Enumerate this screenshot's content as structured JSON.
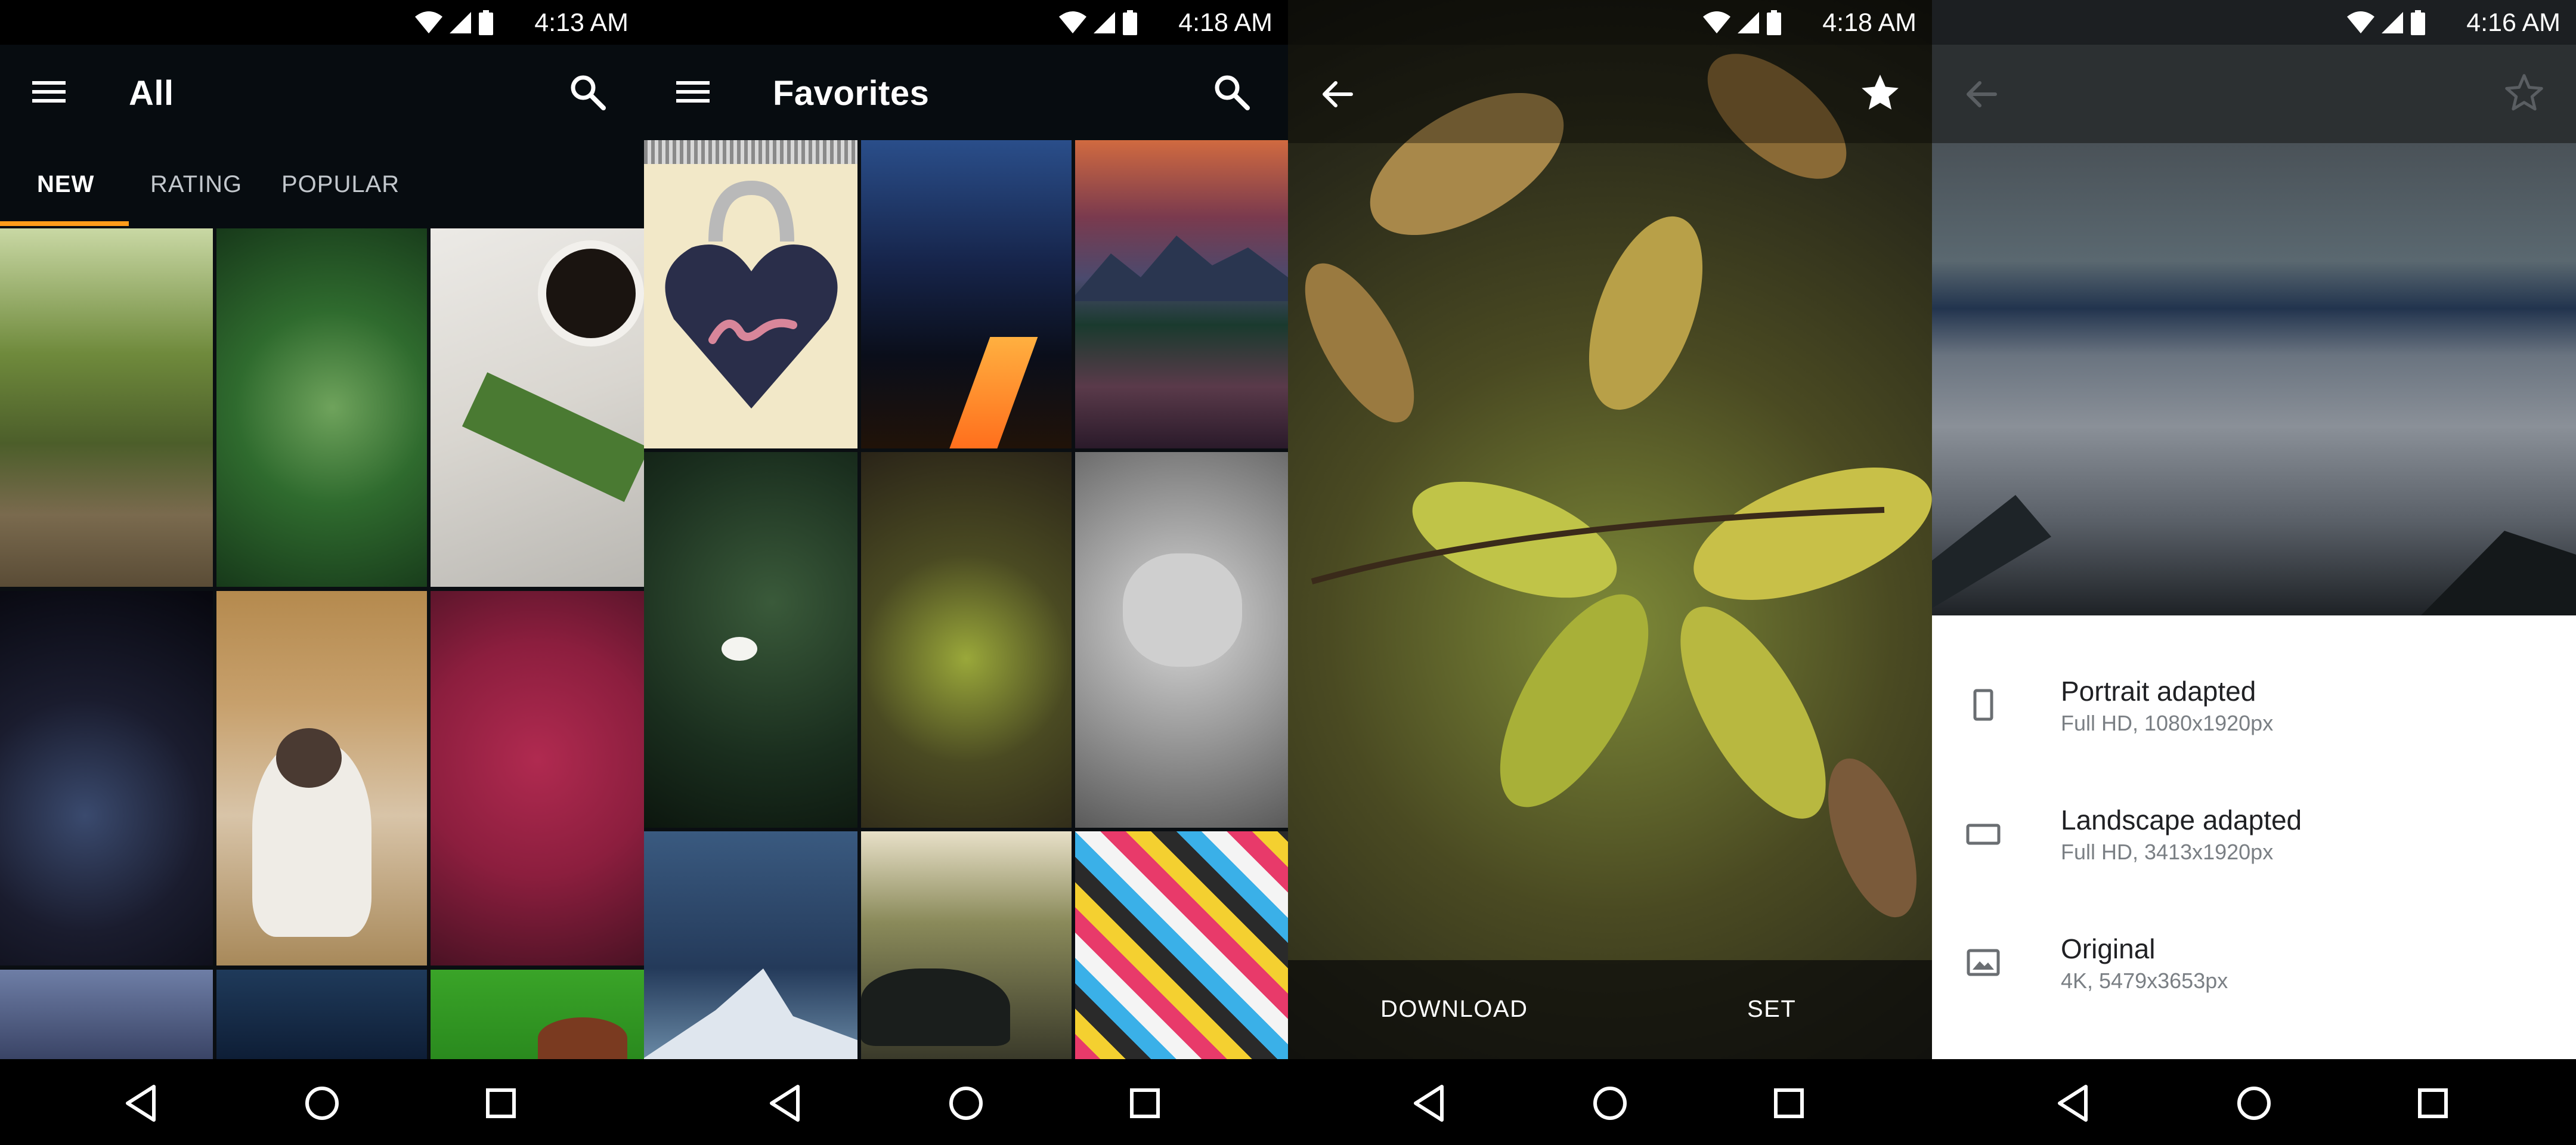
{
  "screens": [
    {
      "status_time": "4:13 AM",
      "title": "All",
      "tabs": [
        "NEW",
        "RATING",
        "POPULAR"
      ],
      "active_tab": "NEW"
    },
    {
      "status_time": "4:18 AM",
      "title": "Favorites"
    },
    {
      "status_time": "4:18 AM",
      "actions": {
        "download": "DOWNLOAD",
        "set": "SET"
      }
    },
    {
      "status_time": "4:16 AM",
      "options": [
        {
          "title": "Portrait adapted",
          "subtitle": "Full HD, 1080x1920px",
          "icon": "portrait-icon"
        },
        {
          "title": "Landscape adapted",
          "subtitle": "Full HD, 3413x1920px",
          "icon": "landscape-icon"
        },
        {
          "title": "Original",
          "subtitle": "4K, 5479x3653px",
          "icon": "image-icon"
        }
      ]
    }
  ],
  "colors": {
    "accent": "#ff9c1a",
    "appbar": "#070c10",
    "sheet": "#ffffff"
  }
}
